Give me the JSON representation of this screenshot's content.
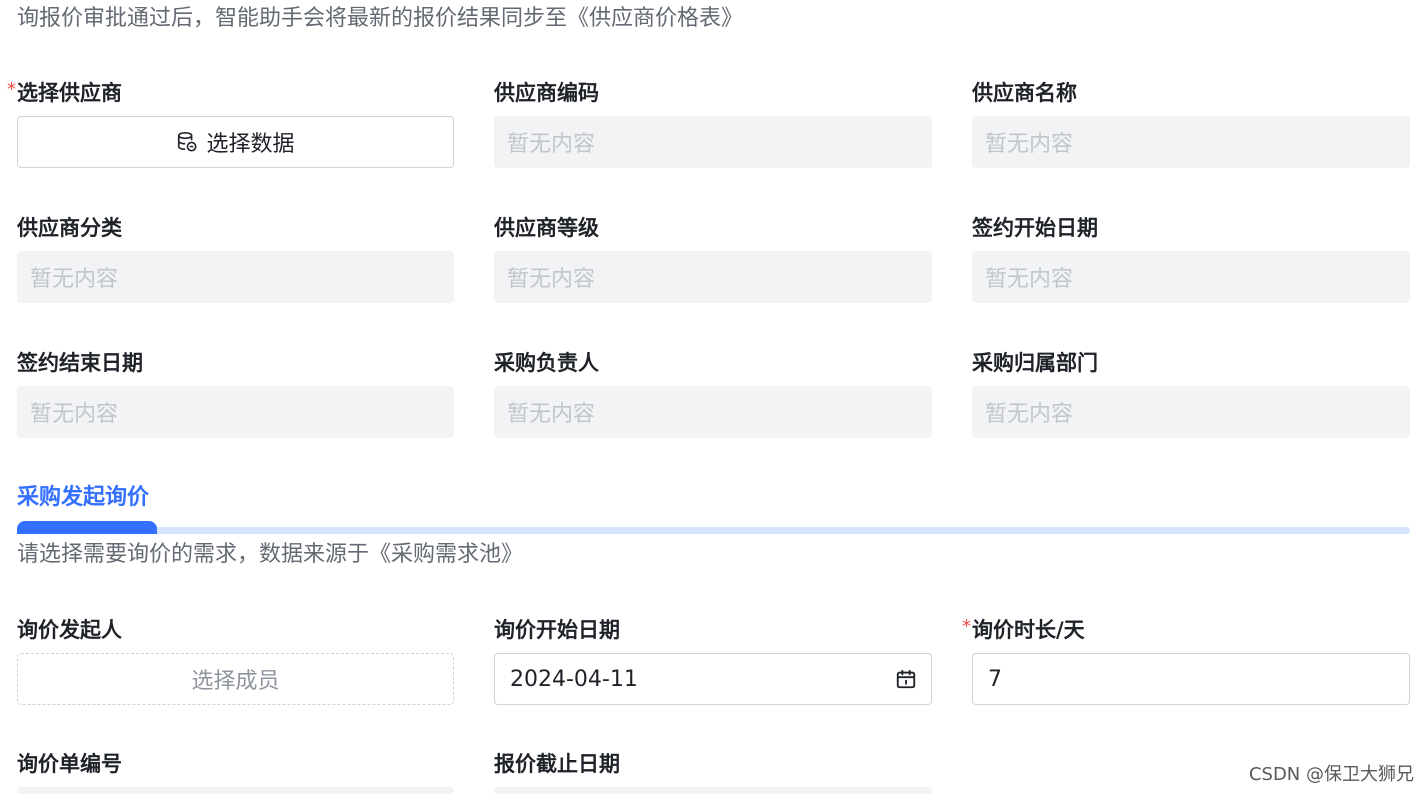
{
  "intro": "询报价审批通过后，智能助手会将最新的报价结果同步至《供应商价格表》",
  "supplier_section": {
    "select_supplier": {
      "label": "选择供应商",
      "required_mark": "*",
      "button_text": "选择数据"
    },
    "fields": [
      {
        "label": "供应商编码",
        "value": "暂无内容"
      },
      {
        "label": "供应商名称",
        "value": "暂无内容"
      },
      {
        "label": "供应商分类",
        "value": "暂无内容"
      },
      {
        "label": "供应商等级",
        "value": "暂无内容"
      },
      {
        "label": "签约开始日期",
        "value": "暂无内容"
      },
      {
        "label": "签约结束日期",
        "value": "暂无内容"
      },
      {
        "label": "采购负责人",
        "value": "暂无内容"
      },
      {
        "label": "采购归属部门",
        "value": "暂无内容"
      }
    ]
  },
  "inquiry_section": {
    "title": "采购发起询价",
    "description": "请选择需要询价的需求，数据来源于《采购需求池》",
    "initiator": {
      "label": "询价发起人",
      "placeholder": "选择成员"
    },
    "start_date": {
      "label": "询价开始日期",
      "value": "2024-04-11"
    },
    "duration": {
      "label": "询价时长/天",
      "required_mark": "*",
      "value": "7"
    },
    "order_no": {
      "label": "询价单编号"
    },
    "deadline": {
      "label": "报价截止日期"
    }
  },
  "watermark": "CSDN @保卫大狮兄",
  "colors": {
    "accent": "#3370ff",
    "required": "#f54a45",
    "readonly_bg": "#f2f3f5",
    "placeholder": "#c2c6cc"
  }
}
